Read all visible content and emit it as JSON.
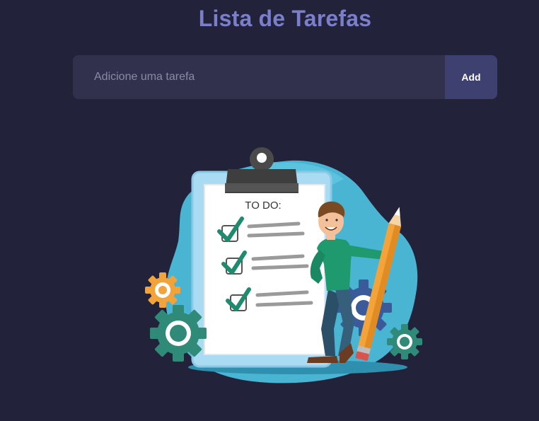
{
  "header": {
    "title": "Lista de Tarefas"
  },
  "form": {
    "input_placeholder": "Adicione uma tarefa",
    "input_value": "",
    "add_label": "Add"
  },
  "illustration": {
    "clipboard_heading": "TO DO:"
  },
  "colors": {
    "background": "#22223a",
    "title": "#7b7fc9",
    "input_bg": "#31314d",
    "button_bg": "#3e4070",
    "blob": "#4ab5d3",
    "check": "#1e8a6e",
    "pencil": "#f2a43a"
  }
}
